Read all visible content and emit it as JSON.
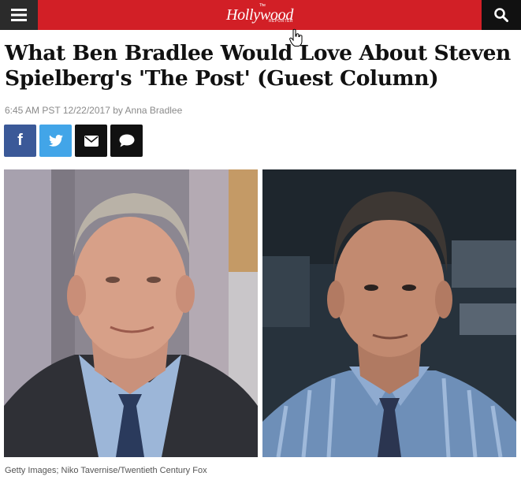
{
  "header": {
    "menu_icon": "hamburger-menu-icon",
    "logo_text": "Hollywood",
    "logo_prefix": "The",
    "logo_suffix": "REPORTER",
    "search_icon": "search-icon",
    "brand_color": "#d21f26",
    "dark_color": "#2b2b2b"
  },
  "article": {
    "title": "What Ben Bradlee Would Love About Steven Spielberg's 'The Post' (Guest Column)",
    "byline": "6:45 AM PST 12/22/2017 by Anna Bradlee"
  },
  "share": {
    "facebook_label": "f",
    "facebook_color": "#3b5998",
    "twitter_icon": "twitter-icon",
    "twitter_color": "#42a5e8",
    "email_icon": "email-icon",
    "comment_icon": "comment-icon"
  },
  "photos": {
    "left": "photo-ben-bradlee",
    "right": "photo-tom-hanks-the-post"
  },
  "caption": "Getty Images; Niko Tavernise/Twentieth Century Fox"
}
